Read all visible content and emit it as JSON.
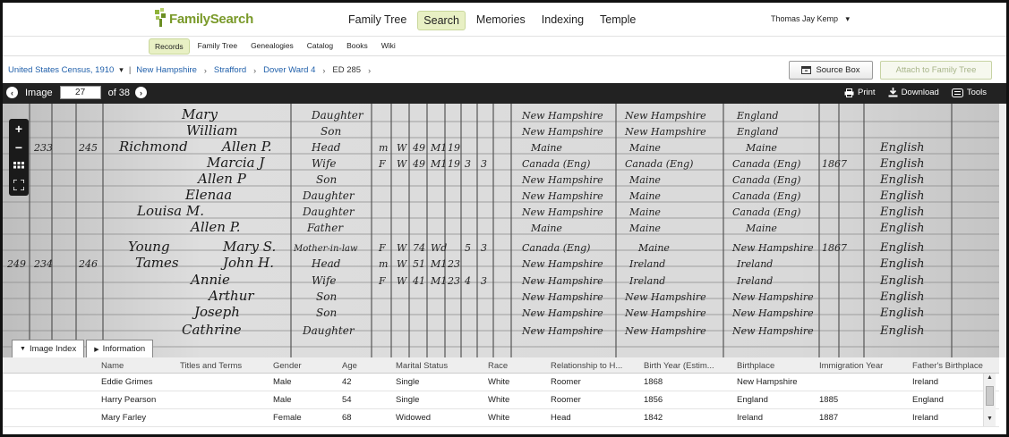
{
  "header": {
    "logo_text": "FamilySearch",
    "nav": [
      {
        "label": "Family Tree",
        "active": false
      },
      {
        "label": "Search",
        "active": true
      },
      {
        "label": "Memories",
        "active": false
      },
      {
        "label": "Indexing",
        "active": false
      },
      {
        "label": "Temple",
        "active": false
      }
    ],
    "user_name": "Thomas Jay Kemp",
    "user_caret": "▾"
  },
  "subnav": [
    {
      "label": "Records",
      "active": true
    },
    {
      "label": "Family Tree",
      "active": false
    },
    {
      "label": "Genealogies",
      "active": false
    },
    {
      "label": "Catalog",
      "active": false
    },
    {
      "label": "Books",
      "active": false
    },
    {
      "label": "Wiki",
      "active": false
    }
  ],
  "breadcrumb": {
    "items": [
      "United States Census, 1910",
      "New Hampshire",
      "Strafford",
      "Dover Ward 4",
      "ED 285"
    ],
    "dropdown_caret": "▾",
    "separator": "›"
  },
  "actions": {
    "source_box_label": "Source Box",
    "attach_label": "Attach to Family Tree"
  },
  "viewer": {
    "image_label": "Image",
    "image_number": "27",
    "of_label": "of 38",
    "print_label": "Print",
    "download_label": "Download",
    "tools_label": "Tools",
    "zoom_in": "+",
    "zoom_out": "−"
  },
  "tabs": {
    "image_index_label": "Image Index",
    "information_label": "Information"
  },
  "index_table": {
    "columns": [
      "Name",
      "Titles and Terms",
      "Gender",
      "Age",
      "Marital Status",
      "Race",
      "Relationship to H...",
      "Birth Year (Estim...",
      "Birthplace",
      "Immigration Year",
      "Father's Birthplace"
    ],
    "rows": [
      [
        "Eddie Grimes",
        "",
        "Male",
        "42",
        "Single",
        "White",
        "Roomer",
        "1868",
        "New Hampshire",
        "",
        "Ireland"
      ],
      [
        "Harry Pearson",
        "",
        "Male",
        "54",
        "Single",
        "White",
        "Roomer",
        "1856",
        "England",
        "1885",
        "England"
      ],
      [
        "Mary Farley",
        "",
        "Female",
        "68",
        "Widowed",
        "White",
        "Head",
        "1842",
        "Ireland",
        "1887",
        "Ireland"
      ]
    ]
  },
  "census_image": {
    "handwriting": [
      "Mary",
      "William",
      "Richmond",
      "Allen P.",
      "Marcia J",
      "Allen P",
      "Elenaa",
      "Louisa M.",
      "Allen P.",
      "Young",
      "Mary S.",
      "Tames",
      "John H.",
      "Annie",
      "Arthur",
      "Joseph",
      "Cathrine",
      "Daughter",
      "Son",
      "Head",
      "Wife",
      "Father",
      "Mother-in-law",
      "New Hampshire",
      "Maine",
      "Canada (Eng)",
      "Ireland",
      "England",
      "English",
      "1867"
    ]
  },
  "colors": {
    "brand_green": "#7a9a2a",
    "active_tab_bg": "#e8f0c4",
    "link_blue": "#1f5faa",
    "viewer_bar": "#222222"
  }
}
